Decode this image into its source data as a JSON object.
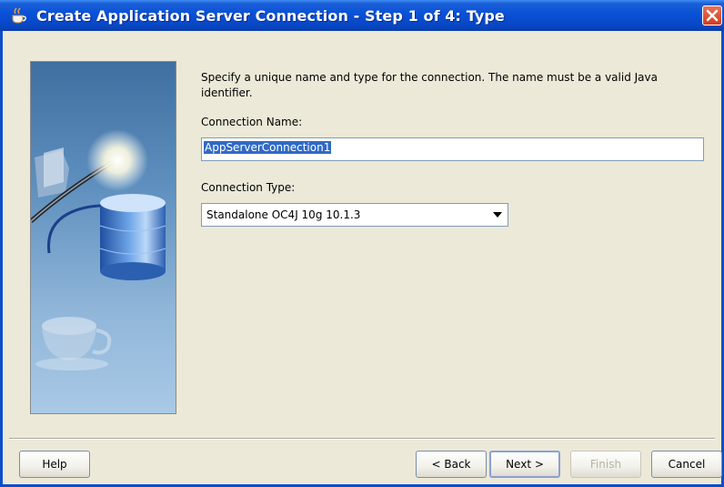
{
  "window": {
    "title": "Create Application Server Connection - Step 1 of 4: Type"
  },
  "content": {
    "description": "Specify a unique name and type for the connection. The name must be a valid Java identifier.",
    "connection_name_label": "Connection Name:",
    "connection_name_value": "AppServerConnection1",
    "connection_type_label": "Connection Type:",
    "connection_type_value": "Standalone OC4J 10g 10.1.3"
  },
  "buttons": {
    "help": "Help",
    "back": "< Back",
    "next": "Next >",
    "finish": "Finish",
    "cancel": "Cancel"
  },
  "colors": {
    "titlebar": "#0a52d8",
    "dialog_bg": "#ece9d8",
    "selection": "#316ac5"
  }
}
